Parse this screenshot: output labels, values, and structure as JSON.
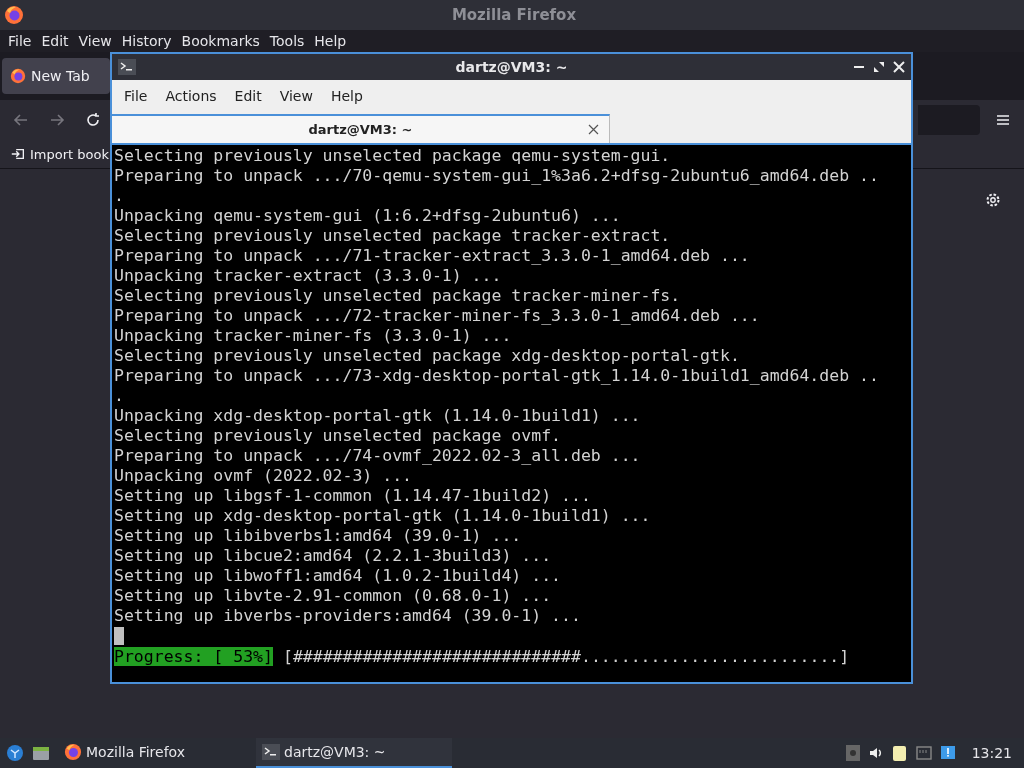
{
  "firefox": {
    "title": "Mozilla Firefox",
    "menu": [
      "File",
      "Edit",
      "View",
      "History",
      "Bookmarks",
      "Tools",
      "Help"
    ],
    "tabs": [
      {
        "label": "New Tab",
        "selected": true
      }
    ],
    "bookmarks": [
      {
        "label": "Import book"
      }
    ]
  },
  "terminal": {
    "title": "dartz@VM3: ~",
    "menu": [
      "File",
      "Actions",
      "Edit",
      "View",
      "Help"
    ],
    "tabs": [
      {
        "label": "dartz@VM3: ~",
        "selected": true
      }
    ],
    "lines": [
      "Selecting previously unselected package qemu-system-gui.",
      "Preparing to unpack .../70-qemu-system-gui_1%3a6.2+dfsg-2ubuntu6_amd64.deb ..",
      ".",
      "Unpacking qemu-system-gui (1:6.2+dfsg-2ubuntu6) ...",
      "Selecting previously unselected package tracker-extract.",
      "Preparing to unpack .../71-tracker-extract_3.3.0-1_amd64.deb ...",
      "Unpacking tracker-extract (3.3.0-1) ...",
      "Selecting previously unselected package tracker-miner-fs.",
      "Preparing to unpack .../72-tracker-miner-fs_3.3.0-1_amd64.deb ...",
      "Unpacking tracker-miner-fs (3.3.0-1) ...",
      "Selecting previously unselected package xdg-desktop-portal-gtk.",
      "Preparing to unpack .../73-xdg-desktop-portal-gtk_1.14.0-1build1_amd64.deb ..",
      ".",
      "Unpacking xdg-desktop-portal-gtk (1.14.0-1build1) ...",
      "Selecting previously unselected package ovmf.",
      "Preparing to unpack .../74-ovmf_2022.02-3_all.deb ...",
      "Unpacking ovmf (2022.02-3) ...",
      "Setting up libgsf-1-common (1.14.47-1build2) ...",
      "Setting up xdg-desktop-portal-gtk (1.14.0-1build1) ...",
      "Setting up libibverbs1:amd64 (39.0-1) ...",
      "Setting up libcue2:amd64 (2.2.1-3build3) ...",
      "Setting up libwoff1:amd64 (1.0.2-1build4) ...",
      "Setting up libvte-2.91-common (0.68.0-1) ...",
      "Setting up ibverbs-providers:amd64 (39.0-1) ..."
    ],
    "progress": {
      "label": "Progress: [ 53%]",
      "bar": "[#############################..........................]"
    }
  },
  "taskbar": {
    "tasks": [
      {
        "label": "Mozilla Firefox",
        "kind": "firefox",
        "selected": false
      },
      {
        "label": "dartz@VM3: ~",
        "kind": "terminal",
        "selected": true
      }
    ],
    "clock": "13:21"
  }
}
